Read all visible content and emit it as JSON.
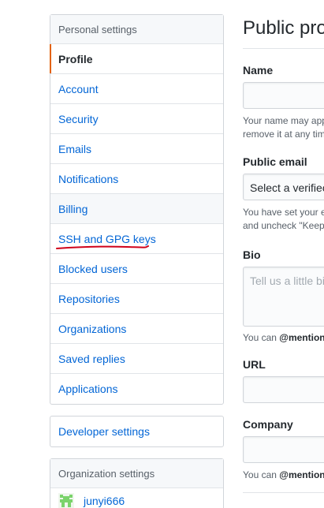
{
  "sidebar": {
    "personal_header": "Personal settings",
    "items": [
      {
        "label": "Profile"
      },
      {
        "label": "Account"
      },
      {
        "label": "Security"
      },
      {
        "label": "Emails"
      },
      {
        "label": "Notifications"
      },
      {
        "label": "Billing"
      },
      {
        "label": "SSH and GPG keys"
      },
      {
        "label": "Blocked users"
      },
      {
        "label": "Repositories"
      },
      {
        "label": "Organizations"
      },
      {
        "label": "Saved replies"
      },
      {
        "label": "Applications"
      }
    ],
    "developer_settings": "Developer settings",
    "org_header": "Organization settings",
    "org_name": "junyi666"
  },
  "main": {
    "title": "Public pro",
    "name_label": "Name",
    "name_note_line1": "Your name may app",
    "name_note_line2": "remove it at any tim",
    "email_label": "Public email",
    "email_select": "Select a verifiec",
    "email_note_line1": "You have set your e",
    "email_note_line2": "and uncheck \"Keep",
    "bio_label": "Bio",
    "bio_placeholder": "Tell us a little bi",
    "bio_note_prefix": "You can ",
    "bio_note_mention": "@mention",
    "url_label": "URL",
    "company_label": "Company",
    "company_note_prefix": "You can ",
    "company_note_mention": "@mention"
  },
  "colors": {
    "link": "#0366d6",
    "selected_accent": "#e36209",
    "annotation": "#d0021b",
    "avatar": "#7bd36b"
  }
}
